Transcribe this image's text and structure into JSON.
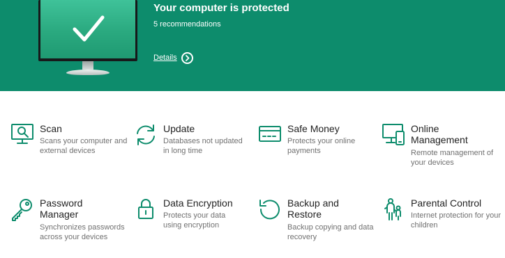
{
  "banner": {
    "title": "Your computer is protected",
    "subtitle": "5 recommendations",
    "details_label": "Details"
  },
  "colors": {
    "accent": "#0d8c6c",
    "title_text": "#222222",
    "desc_text": "#707070"
  },
  "tiles": [
    {
      "icon": "scan-monitor-icon",
      "title": "Scan",
      "description": "Scans your computer and external devices"
    },
    {
      "icon": "refresh-icon",
      "title": "Update",
      "description": "Databases not updated in long time"
    },
    {
      "icon": "credit-card-icon",
      "title": "Safe Money",
      "description": "Protects your online payments"
    },
    {
      "icon": "devices-icon",
      "title": "Online Management",
      "description": "Remote management of your devices"
    },
    {
      "icon": "key-icon",
      "title": "Password Manager",
      "description": "Synchronizes passwords across your devices"
    },
    {
      "icon": "padlock-icon",
      "title": "Data Encryption",
      "description": "Protects your data using encryption"
    },
    {
      "icon": "restore-arrow-icon",
      "title": "Backup and Restore",
      "description": "Backup copying and data recovery"
    },
    {
      "icon": "family-icon",
      "title": "Parental Control",
      "description": "Internet protection for your children"
    }
  ]
}
